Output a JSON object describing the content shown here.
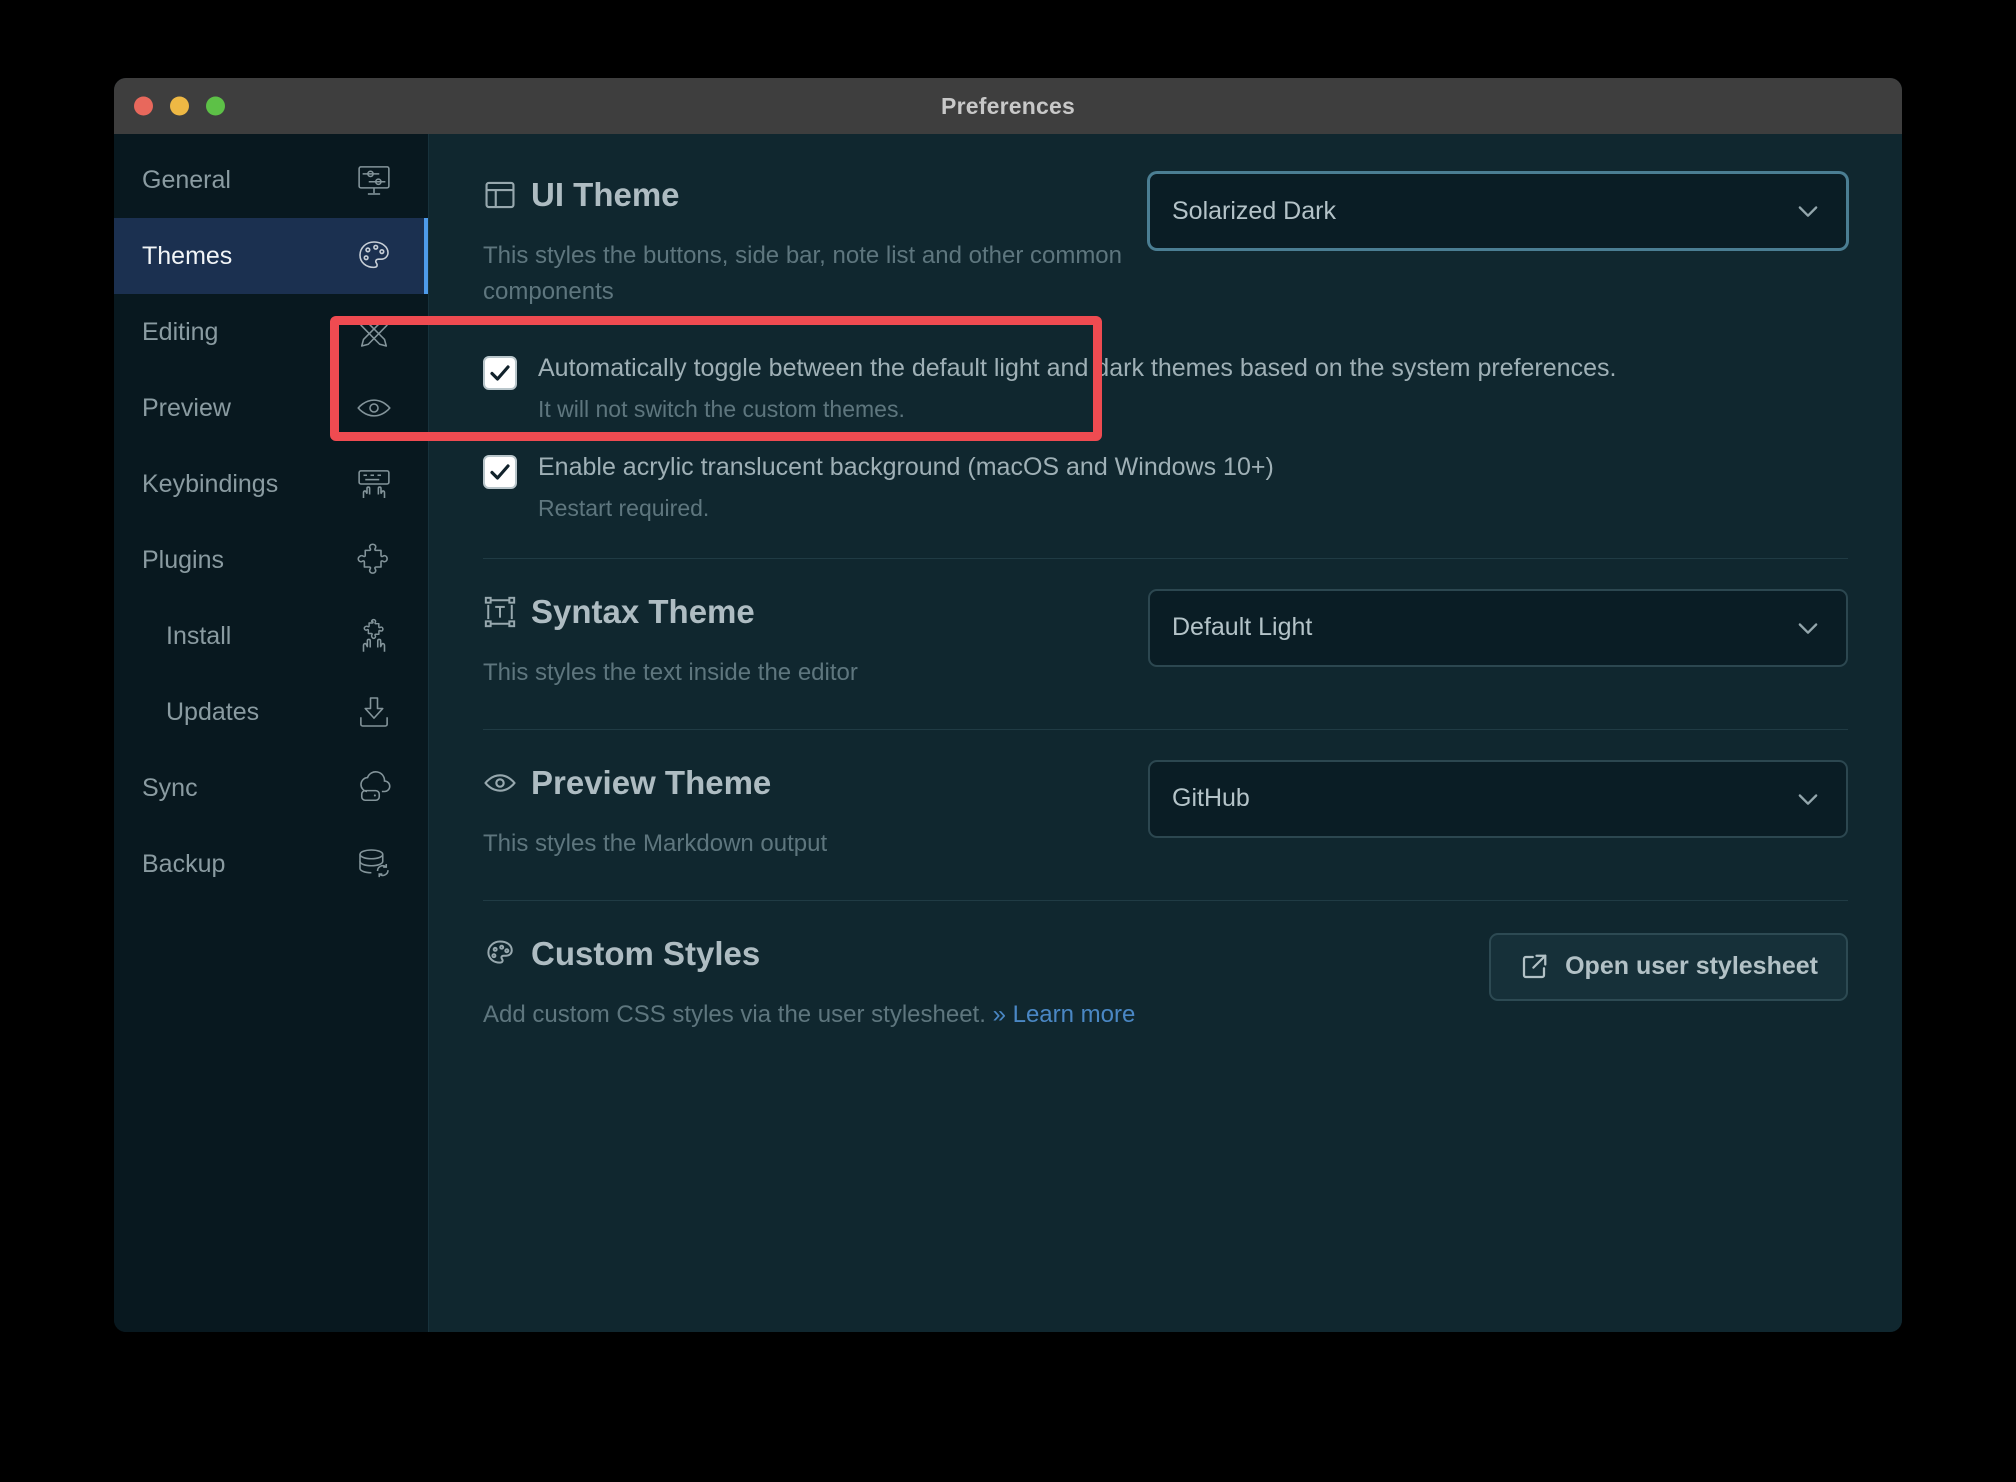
{
  "window": {
    "title": "Preferences",
    "traffic_lights": [
      "close-red",
      "minimize-yellow",
      "maximize-green"
    ]
  },
  "sidebar": {
    "items": [
      {
        "label": "General",
        "icon": "monitor-sliders-icon",
        "active": false,
        "sub": false
      },
      {
        "label": "Themes",
        "icon": "palette-icon",
        "active": true,
        "sub": false
      },
      {
        "label": "Editing",
        "icon": "crossed-pens-icon",
        "active": false,
        "sub": false
      },
      {
        "label": "Preview",
        "icon": "eye-icon",
        "active": false,
        "sub": false
      },
      {
        "label": "Keybindings",
        "icon": "keyboard-hands-icon",
        "active": false,
        "sub": false
      },
      {
        "label": "Plugins",
        "icon": "puzzle-piece-icon",
        "active": false,
        "sub": false
      },
      {
        "label": "Install",
        "icon": "puzzle-in-hands-icon",
        "active": false,
        "sub": true
      },
      {
        "label": "Updates",
        "icon": "download-arrow-icon",
        "active": false,
        "sub": true
      },
      {
        "label": "Sync",
        "icon": "cloud-server-icon",
        "active": false,
        "sub": false
      },
      {
        "label": "Backup",
        "icon": "database-refresh-icon",
        "active": false,
        "sub": false
      }
    ]
  },
  "main": {
    "ui_theme": {
      "icon": "layout-panel-icon",
      "title": "UI Theme",
      "description": "This styles the buttons, side bar, note list and other common components",
      "select_value": "Solarized Dark",
      "select_focused": true,
      "checkboxes": [
        {
          "checked": true,
          "label": "Automatically toggle between the default light and dark themes based on the system preferences.",
          "sublabel": "It will not switch the custom themes."
        },
        {
          "checked": true,
          "label": "Enable acrylic translucent background (macOS and Windows 10+)",
          "sublabel": "Restart required."
        }
      ]
    },
    "syntax_theme": {
      "icon": "text-frame-icon",
      "title": "Syntax Theme",
      "description": "This styles the text inside the editor",
      "select_value": "Default Light"
    },
    "preview_theme": {
      "icon": "eye-icon",
      "title": "Preview Theme",
      "description": "This styles the Markdown output",
      "select_value": "GitHub"
    },
    "custom_styles": {
      "icon": "palette-icon",
      "title": "Custom Styles",
      "description": "Add custom CSS styles via the user stylesheet.",
      "link_chevron": "»",
      "link_text": "Learn more",
      "button_label": "Open user stylesheet",
      "button_icon": "external-link-icon"
    }
  },
  "annotation": {
    "highlight_color": "#ef4b51",
    "target": "Enable acrylic translucent background (macOS and Windows 10+)"
  },
  "colors": {
    "window_bg": "#10272f",
    "sidebar_bg": "#08181f",
    "titlebar_bg": "#3e3e3e",
    "active_item_bg": "#1b3050",
    "accent_blue": "#4e9bea",
    "link_blue": "#4a87c4",
    "highlight_red": "#ef4b51"
  }
}
